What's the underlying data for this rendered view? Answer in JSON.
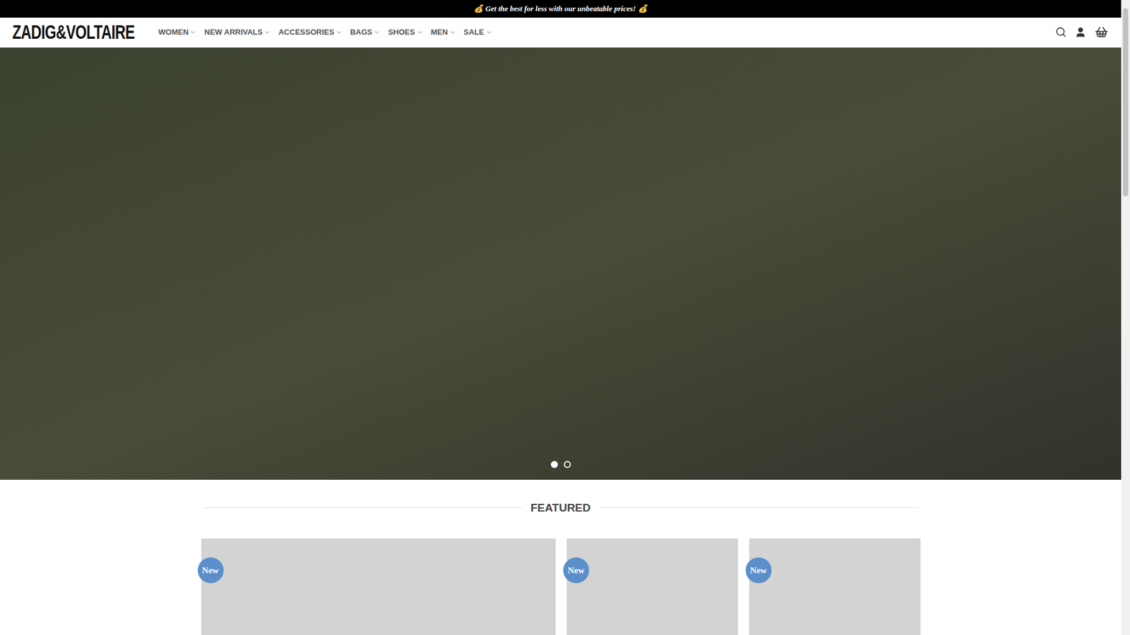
{
  "announcement": "💰 Get the best for less with our unbeatable prices! 💰",
  "logo": "ZADIG&VOLTAIRE",
  "nav": [
    {
      "label": "WOMEN"
    },
    {
      "label": "NEW ARRIVALS"
    },
    {
      "label": "ACCESSORIES"
    },
    {
      "label": "BAGS"
    },
    {
      "label": "SHOES"
    },
    {
      "label": "MEN"
    },
    {
      "label": "SALE"
    }
  ],
  "hero": {
    "slides": [
      {
        "selected": true
      },
      {
        "selected": false
      }
    ]
  },
  "featured": {
    "heading": "FEATURED"
  },
  "products": [
    {
      "badge": "New"
    },
    {
      "badge": "New"
    },
    {
      "badge": "New"
    }
  ]
}
